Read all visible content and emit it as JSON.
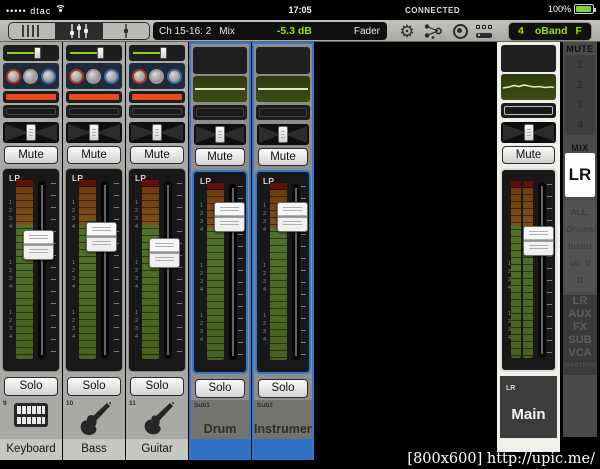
{
  "status_bar": {
    "signal_dots": "•••••",
    "carrier": "dtac",
    "time": "17:05",
    "connection": "CONNECTED",
    "battery": "100%"
  },
  "toolbar": {
    "display": {
      "channel": "Ch 15-16: 2",
      "bus": "Mix",
      "value": "-5.3 dB",
      "mode": "Fader"
    },
    "preset": {
      "count": "4",
      "name": "oBand",
      "page": "F"
    }
  },
  "labels": {
    "mute": "Mute",
    "solo": "Solo"
  },
  "fader": {
    "scale_group": "1\n2\n3\n4"
  },
  "channels": [
    {
      "id": "9",
      "name": "Keyboard",
      "route": "LR",
      "fader_top": "30%"
    },
    {
      "id": "10",
      "name": "Bass",
      "route": "LR",
      "fader_top": "26%"
    },
    {
      "id": "11",
      "name": "Guitar",
      "route": "LR",
      "fader_top": "34%"
    },
    {
      "id": "Sub1",
      "name": "Drum",
      "route": "LR",
      "fader_top": "15%"
    },
    {
      "id": "Sub2",
      "name": "Instrument",
      "route": "LR",
      "fader_top": "15%"
    }
  ],
  "master": {
    "route": "LR",
    "name": "Main",
    "fader_top": "28%"
  },
  "sidebar": {
    "mute_header": "MUTE",
    "mute_groups": [
      "1",
      "2",
      "3",
      "4"
    ],
    "mix_header": "MIX",
    "selected_mix": "LR",
    "view_list": "ALL,\nDrums\nInstru\nub. V\nD",
    "mix_types": [
      "LR",
      "AUX",
      "FX",
      "SUB",
      "VCA"
    ],
    "masters_label": "MASTERS"
  },
  "colors": {
    "accent_blue": "#3577c8",
    "accent_green": "#9be000",
    "alert_red": "#e8491f",
    "meter_green": "#50722a",
    "meter_brown": "#7e501a"
  },
  "watermark": "[800x600] http://upic.me/"
}
